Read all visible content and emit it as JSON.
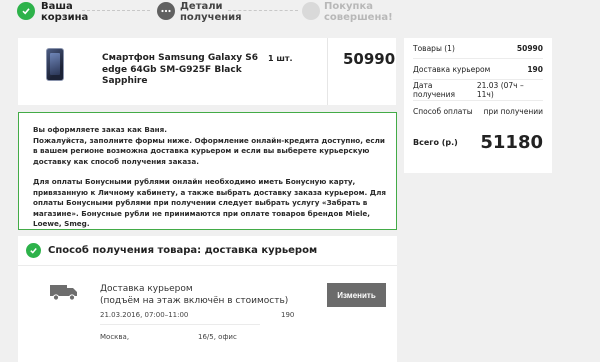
{
  "steps": [
    {
      "line1": "Ваша",
      "line2": "корзина",
      "state": "done"
    },
    {
      "line1": "Детали",
      "line2": "получения",
      "state": "current"
    },
    {
      "line1": "Покупка",
      "line2": "совершена!",
      "state": "pending"
    }
  ],
  "product": {
    "name": "Смартфон Samsung Galaxy S6 edge 64Gb SM-G925F Black Sapphire",
    "quantity": "1 шт.",
    "price": "50990"
  },
  "summary": {
    "rows": [
      {
        "label": "Товары (1)",
        "value": "50990"
      },
      {
        "label": "Доставка курьером",
        "value": "190"
      },
      {
        "label": "Дата получения",
        "value": "21.03 (07ч – 11ч)"
      },
      {
        "label": "Способ оплаты",
        "value": "при получении"
      }
    ],
    "total_label": "Всего (р.)",
    "total_value": "51180"
  },
  "notice": {
    "p1": "Вы оформляете заказ как Ваня.",
    "p2": "Пожалуйста, заполните формы ниже. Оформление онлайн-кредита доступно, если в вашем регионе возможна доставка курьером и если вы выберете курьерскую доставку как способ получения заказа.",
    "p3": "Для оплаты Бонусными рублями онлайн необходимо иметь Бонусную карту, привязанную к Личному кабинету, а также выбрать доставку заказа курьером. Для оплаты Бонусными рублями при получении следует выбрать услугу «Забрать в магазине». Бонусные рубли не принимаются при оплате товаров брендов Miele, Loewe, Smeg."
  },
  "delivery": {
    "title": "Способ получения товара: доставка курьером",
    "method_line1": "Доставка курьером",
    "method_line2": "(подъём на этаж включён в стоимость)",
    "change_label": "Изменить",
    "date": "21.03.2016, 07:00–11:00",
    "cost": "190",
    "city": "Москва,",
    "address": "16/5, офис"
  },
  "colors": {
    "accent": "#2db24a",
    "button": "#6b6b6b"
  }
}
